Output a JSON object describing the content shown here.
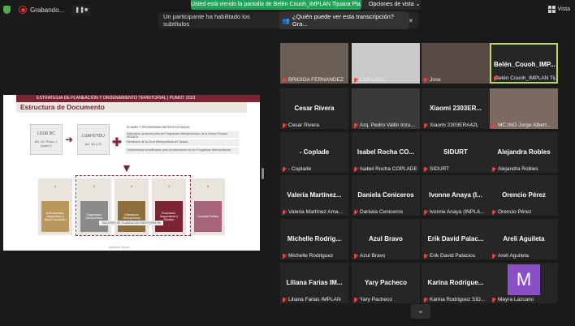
{
  "recording": {
    "label": "Grabando..."
  },
  "share_banner": "Usted está viendo la pantalla de Belén Couoh_IMPLAN Tijuana Pla...",
  "view_options": "Opciones de vista",
  "view_toggle": "Vista",
  "notification": {
    "text": "Un participante ha habilitado los subtítulos",
    "question": "¿Quién puede ver esta transcripción? Gra..."
  },
  "slide": {
    "header": "ESTRATEGIA DE PLANEACIÓN Y ORDENAMIENTO TERRITORIAL | PUMOT 2023",
    "title": "Estructura de Documento",
    "left_box": {
      "title": "LDUE BC",
      "body": "Art. 24, Fracc. I, punto 2"
    },
    "mid_box": {
      "title": "LGAHOTDU",
      "body": "Art. 34 y 37"
    },
    "plans_header": "PLANES Y PROGRAMAS METROPOLITANOS",
    "plans": [
      "Estructura, alcances para los Programas Metropolitanos, de la Nueva Técnica SEDATU",
      "Directrices de la Zona Metropolitana de Tijuana",
      "Lineamientos simplificados para la elaboración de los Programas Metropolitanos"
    ],
    "steps": [
      {
        "n": "1",
        "label": "Antecedentes, Diagnóstico y Marco Normativo"
      },
      {
        "n": "2",
        "label": "Diagnóstico Metropolitano"
      },
      {
        "n": "3",
        "label": "Planeación Metropolitana"
      },
      {
        "n": "4",
        "label": "Evaluación, Seguimiento y Difusión"
      },
      {
        "n": "5",
        "label": "Consulta Pública"
      }
    ],
    "workshop": "TALLERES DE PLANEACIÓN PARTICIPATIVA",
    "footer": "@ImplanTijuana"
  },
  "participants": [
    {
      "name": "",
      "label": "BRIGIDA FERNANDEZ",
      "video": true
    },
    {
      "name": "",
      "label": "COPLADE",
      "video": true
    },
    {
      "name": "",
      "label": "Jose",
      "video": true
    },
    {
      "name": "Belén_Couoh_IMP...",
      "label": "Belén Couoh_IMPLAN Tij...",
      "video": false,
      "active": true
    },
    {
      "name": "Cesar Rivera",
      "label": "Cesar Rivera"
    },
    {
      "name": "",
      "label": "Arq. Pedro Vallin Inzu...",
      "video": true
    },
    {
      "name": "Xiaomi 2303ER...",
      "label": "Xiaomi 2303ERA42L"
    },
    {
      "name": "",
      "label": "MC.ING Jorge Albert...",
      "video": true
    },
    {
      "name": "- Coplade",
      "label": "- Coplade"
    },
    {
      "name": "Isabel Rocha CO...",
      "label": "Isabel Rocha COPLADE"
    },
    {
      "name": "SIDURT",
      "label": "SIDURT"
    },
    {
      "name": "Alejandra Robles",
      "label": "Alejandra Robles"
    },
    {
      "name": "Valeria Martínez...",
      "label": "Valeria Martínez Ama..."
    },
    {
      "name": "Daniela Ceniceros",
      "label": "Daniela Ceniceros"
    },
    {
      "name": "Ivonne Anaya (I...",
      "label": "Ivonne Anaya (INPLA..."
    },
    {
      "name": "Orencio Pérez",
      "label": "Orencio Pérez"
    },
    {
      "name": "Michelle Rodrig...",
      "label": "Michelle Rodriguez"
    },
    {
      "name": "Azul Bravo",
      "label": "Azul Bravo"
    },
    {
      "name": "Erik David Palac...",
      "label": "Erik David Palacios"
    },
    {
      "name": "Areli Aguileta",
      "label": "Areli Aguileta"
    },
    {
      "name": "Liliana Farias IM...",
      "label": "Liliana Farias IMPLAN"
    },
    {
      "name": "Yary Pacheco",
      "label": "Yary Pacheco"
    },
    {
      "name": "Karina Rodrigue...",
      "label": "Karina Rodriguez SID..."
    },
    {
      "name": "",
      "label": "Mayra Lazcano",
      "avatar": "M"
    }
  ]
}
